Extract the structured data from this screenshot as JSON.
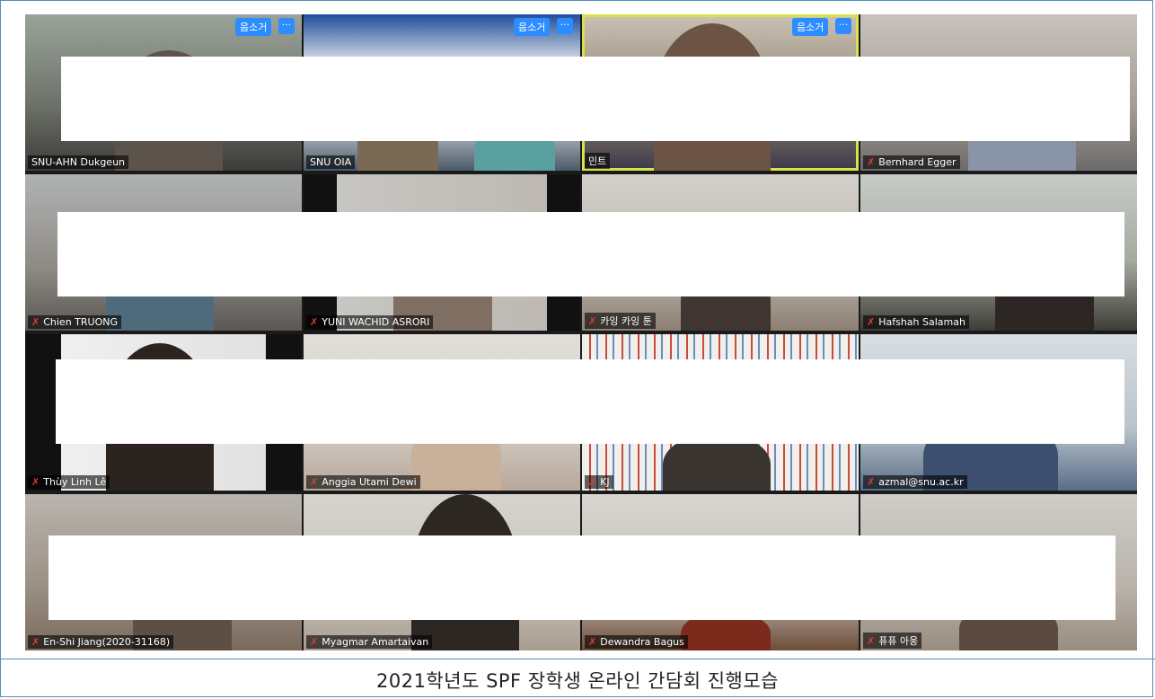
{
  "caption": "2021학년도 SPF 장학생 온라인 간담회 진행모습",
  "controls": {
    "unmute_label": "음소거",
    "more_label": "···"
  },
  "participants": [
    {
      "name": "SNU-AHN Dukgeun",
      "muted": false
    },
    {
      "name": "SNU OIA",
      "muted": false
    },
    {
      "name": "민트",
      "muted": false
    },
    {
      "name": "Bernhard Egger",
      "muted": true
    },
    {
      "name": "Chien TRUONG",
      "muted": true
    },
    {
      "name": "YUNI WACHID ASRORI",
      "muted": true
    },
    {
      "name": "카잉 카잉 툰",
      "muted": true
    },
    {
      "name": "Hafshah Salamah",
      "muted": true
    },
    {
      "name": "Thùy Linh Lê",
      "muted": true
    },
    {
      "name": "Anggia Utami Dewi",
      "muted": true
    },
    {
      "name": "KJ",
      "muted": true
    },
    {
      "name": "azmal@snu.ac.kr",
      "muted": true
    },
    {
      "name": "En-Shi Jiang(2020-31168)",
      "muted": true
    },
    {
      "name": "Myagmar Amartaivan",
      "muted": true
    },
    {
      "name": "Dewandra Bagus",
      "muted": true
    },
    {
      "name": "퓨퓨 아웅",
      "muted": true
    }
  ],
  "colors": {
    "accent": "#2d8cff",
    "active_speaker": "#d8e24a",
    "muted_icon": "#e23a2f",
    "frame": "#4a90b8"
  },
  "icons": {
    "muted": "mic-off-icon"
  }
}
